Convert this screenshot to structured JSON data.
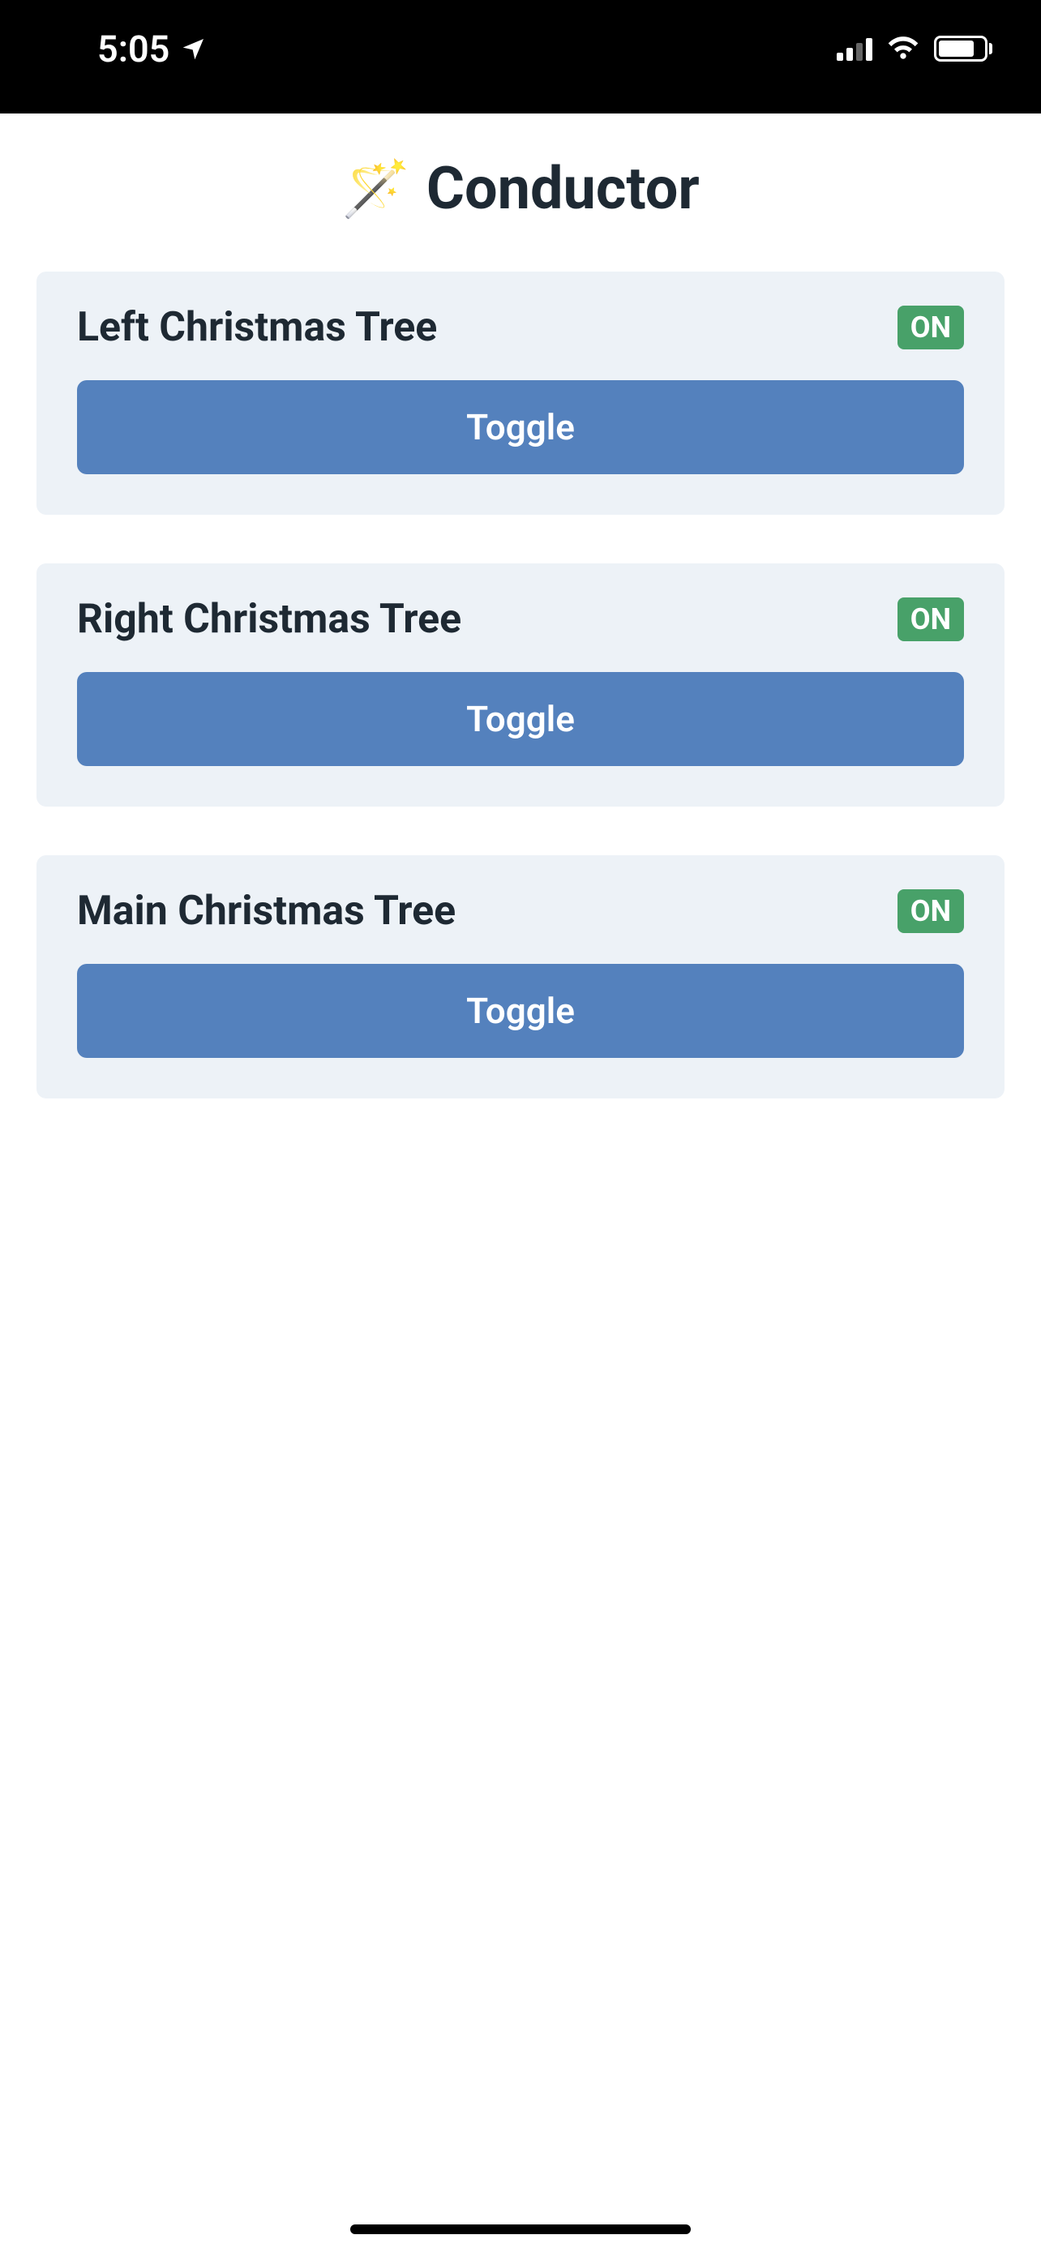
{
  "status_bar": {
    "time": "5:05"
  },
  "app": {
    "title": "Conductor",
    "icon": "🪄"
  },
  "devices": [
    {
      "name": "Left Christmas Tree",
      "status": "ON",
      "button_label": "Toggle"
    },
    {
      "name": "Right Christmas Tree",
      "status": "ON",
      "button_label": "Toggle"
    },
    {
      "name": "Main Christmas Tree",
      "status": "ON",
      "button_label": "Toggle"
    }
  ]
}
